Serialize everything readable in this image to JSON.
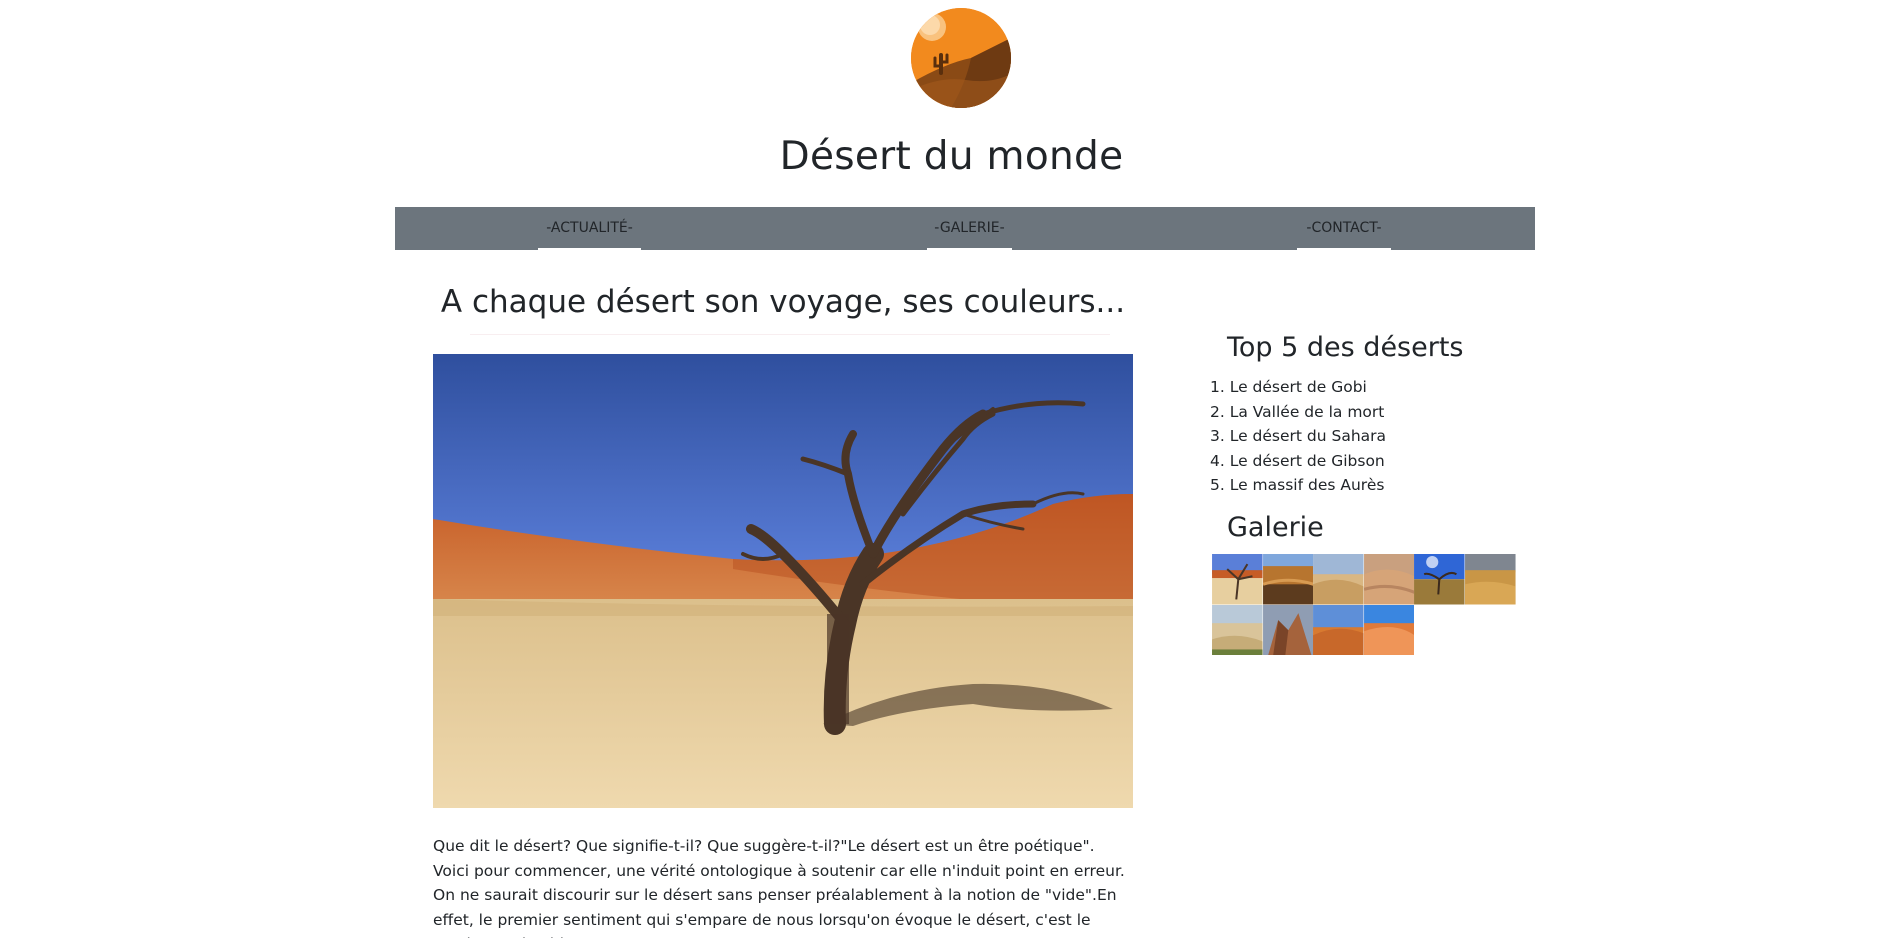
{
  "site": {
    "logo_name": "desert-cactus-logo",
    "title": "Désert du monde"
  },
  "nav": {
    "items": [
      "-ACTUALITÉ-",
      "-GALERIE-",
      "-CONTACT-"
    ]
  },
  "main": {
    "heading": "A chaque désert son voyage, ses couleurs...",
    "hero_image": "dead-tree-in-desert",
    "intro": "Que dit le désert? Que signifie-t-il? Que suggère-t-il?\"Le désert est un être poétique\". Voici pour commencer, une vérité ontologique à soutenir car elle n'induit point en erreur. On ne saurait discourir sur le désert sans penser préalablement à la notion de \"vide\".En effet, le premier sentiment qui s'empare de nous lorsqu'on évoque le désert, c'est le sentiment de vide."
  },
  "sidebar": {
    "top_heading": "Top 5 des déserts",
    "top_items": [
      "1. Le désert de Gobi",
      "2. La Vallée de la mort",
      "3. Le désert du Sahara",
      "4. Le désert de Gibson",
      "5. Le massif des Aurès"
    ],
    "gallery_heading": "Galerie",
    "gallery_count": 10
  },
  "colors": {
    "nav_bg": "#6c757d",
    "logo_orange": "#f28a1e",
    "text": "#212529",
    "sky": "#5a7fd8",
    "dune": "#c9642e",
    "sand": "#e7cf9f"
  }
}
